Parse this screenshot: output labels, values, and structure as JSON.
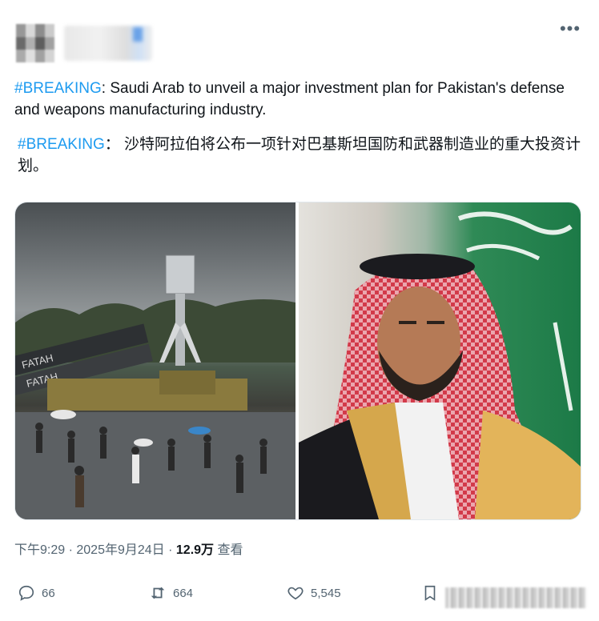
{
  "post": {
    "text_en_hashtag": "#BREAKING",
    "text_en_body": ": Saudi Arab to unveil a major investment plan for Pakistan's defense and weapons manufacturing industry.",
    "text_zh_hashtag": "#BREAKING",
    "text_zh_body": "： 沙特阿拉伯将公布一项针对巴基斯坦国防和武器制造业的重大投资计划。",
    "images": [
      {
        "desc_name": "missile-parade-photo",
        "label_text": "FATAH"
      },
      {
        "desc_name": "saudi-prince-photo"
      }
    ],
    "time": "下午9:29",
    "separator": " · ",
    "date": "2025年9月24日",
    "views_count": "12.9万",
    "views_label": "查看"
  },
  "actions": {
    "replies": "66",
    "reposts": "664",
    "likes": "5,545"
  },
  "colors": {
    "accent": "#1d9bf0",
    "text": "#0f1419",
    "muted": "#536471"
  }
}
